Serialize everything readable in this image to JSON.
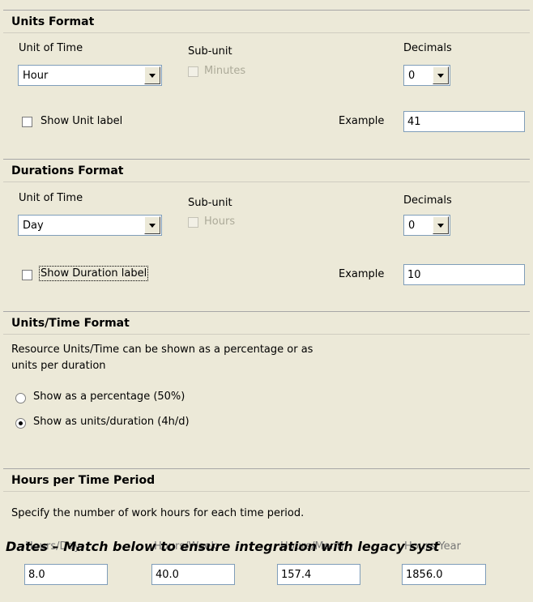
{
  "units_format": {
    "title": "Units Format",
    "unit_of_time_label": "Unit of Time",
    "unit_of_time_value": "Hour",
    "subunit_label": "Sub-unit",
    "subunit_value": "Minutes",
    "decimals_label": "Decimals",
    "decimals_value": "0",
    "show_label": "Show Unit label",
    "example_label": "Example",
    "example_value": "41"
  },
  "durations_format": {
    "title": "Durations Format",
    "unit_of_time_label": "Unit of Time",
    "unit_of_time_value": "Day",
    "subunit_label": "Sub-unit",
    "subunit_value": "Hours",
    "decimals_label": "Decimals",
    "decimals_value": "0",
    "show_label": "Show Duration label",
    "example_label": "Example",
    "example_value": "10"
  },
  "units_time_format": {
    "title": "Units/Time Format",
    "description_line1": "Resource Units/Time can be shown as a percentage or as",
    "description_line2": "units per duration",
    "option_percentage": "Show as a percentage (50%)",
    "option_units_duration": "Show as units/duration (4h/d)",
    "selected": "units_duration"
  },
  "hours_per_time_period": {
    "title": "Hours per Time Period",
    "description": "Specify the number of work hours for each time period.",
    "fields": [
      {
        "label": "Hours/Day",
        "value": "8.0"
      },
      {
        "label": "Hours/Week",
        "value": "40.0"
      },
      {
        "label": "Hours/Month",
        "value": "157.4"
      },
      {
        "label": "Hours/Year",
        "value": "1856.0"
      }
    ]
  },
  "overlay_text": "Dates – Match below to ensure integration with legacy syst"
}
